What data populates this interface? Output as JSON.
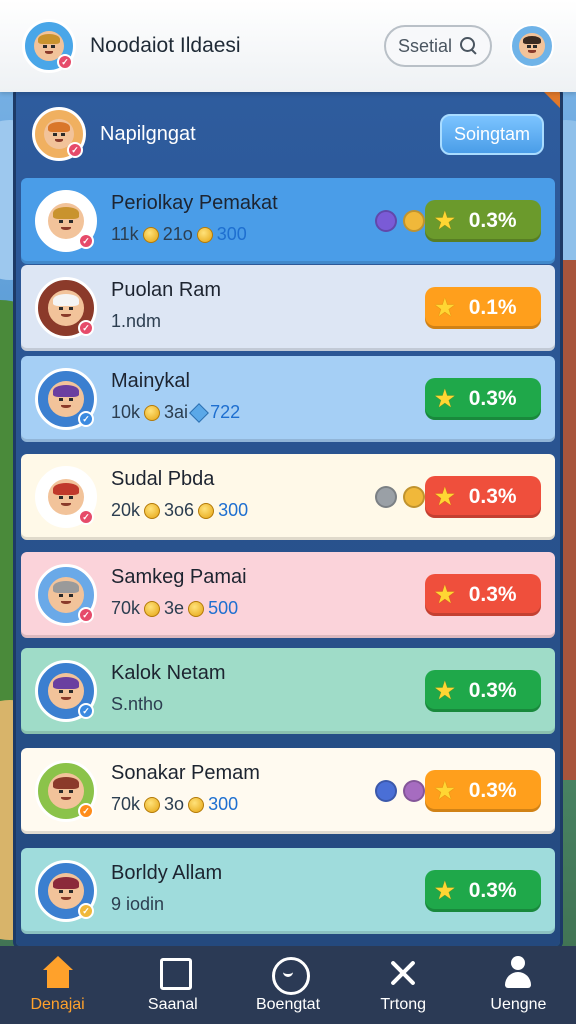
{
  "header": {
    "title": "Noodaiot Ildaesi",
    "search_label": "Ssetial"
  },
  "panel": {
    "title": "Napilgngat",
    "button_label": "Soingtam"
  },
  "players": [
    {
      "name": "Periolkay Pemakat",
      "stat_a": "11k",
      "stat_b": "21o",
      "stat_c": "300",
      "stat_c_icon": "coin",
      "score": "0.3%",
      "row_color": "#4a9de8",
      "score_color": "#6b9a2c",
      "avatar_bg": "#ffffff",
      "hair": "#c9932e",
      "badge": "#e64b6a",
      "orbs": [
        "#7a5bd6",
        "#f0b83a"
      ]
    },
    {
      "name": "Puolan Ram",
      "stat_a": "1.ndm",
      "score": "0.1%",
      "row_color": "#dde6f4",
      "score_color": "#ff9f1c",
      "avatar_bg": "#8b3a2a",
      "hair": "#f4f4f4",
      "badge": "#e64b6a",
      "orbs": []
    },
    {
      "name": "Mainykal",
      "stat_a": "10k",
      "stat_b": "3ai",
      "stat_c": "722",
      "stat_c_icon": "gem",
      "score": "0.3%",
      "row_color": "#a5cff5",
      "score_color": "#1fa84a",
      "avatar_bg": "#3b7fd0",
      "hair": "#6a3fa0",
      "badge": "#3b8ae0",
      "orbs": []
    },
    {
      "name": "Sudal Pbda",
      "stat_a": "20k",
      "stat_b": "3o6",
      "stat_c": "300",
      "stat_c_icon": "coin",
      "score": "0.3%",
      "row_color": "#fff9e8",
      "score_color": "#ef4f3c",
      "avatar_bg": "#ffffff",
      "hair": "#c0392b",
      "badge": "#e64b6a",
      "orbs": [
        "#9aa0a6",
        "#f0b83a"
      ]
    },
    {
      "name": "Samkeg Pamai",
      "stat_a": "70k",
      "stat_b": "3e",
      "stat_c": "500",
      "stat_c_icon": "coin",
      "score": "0.3%",
      "row_color": "#fbd3da",
      "score_color": "#ef4f3c",
      "avatar_bg": "#6aa9e8",
      "hair": "#9a9a9a",
      "badge": "#e64b6a",
      "orbs": []
    },
    {
      "name": "Kalok Netam",
      "stat_a": "S.ntho",
      "score": "0.3%",
      "row_color": "#9fdcc8",
      "score_color": "#1fa84a",
      "avatar_bg": "#3b7fd0",
      "hair": "#6a3fa0",
      "badge": "#3b8ae0",
      "orbs": []
    },
    {
      "name": "Sonakar Pemam",
      "stat_a": "70k",
      "stat_b": "3o",
      "stat_c": "300",
      "stat_c_icon": "coin",
      "score": "0.3%",
      "row_color": "#fffaf0",
      "score_color": "#ff9f1c",
      "avatar_bg": "#8bc34a",
      "hair": "#8b3a2a",
      "badge": "#ff8c1a",
      "orbs": [
        "#4a6fd6",
        "#a66cc0"
      ]
    },
    {
      "name": "Borldy Allam",
      "stat_a": "9 iodin",
      "score": "0.3%",
      "row_color": "#9fdcdc",
      "score_color": "#1fa84a",
      "avatar_bg": "#3b7fd0",
      "hair": "#8b2a3a",
      "badge": "#f0b83a",
      "orbs": []
    }
  ],
  "nav": [
    {
      "label": "Denajai",
      "icon": "home-icon",
      "active": true
    },
    {
      "label": "Saanal",
      "icon": "home-outline-icon",
      "active": false
    },
    {
      "label": "Boengtat",
      "icon": "smiley-ring-icon",
      "active": false
    },
    {
      "label": "Trtong",
      "icon": "cross-icon",
      "active": false
    },
    {
      "label": "Uengne",
      "icon": "user-icon",
      "active": false
    }
  ],
  "colors": {
    "accent_orange": "#ffa12b",
    "panel_blue": "#2e5c9e",
    "nav_bg": "#2b3a55"
  }
}
